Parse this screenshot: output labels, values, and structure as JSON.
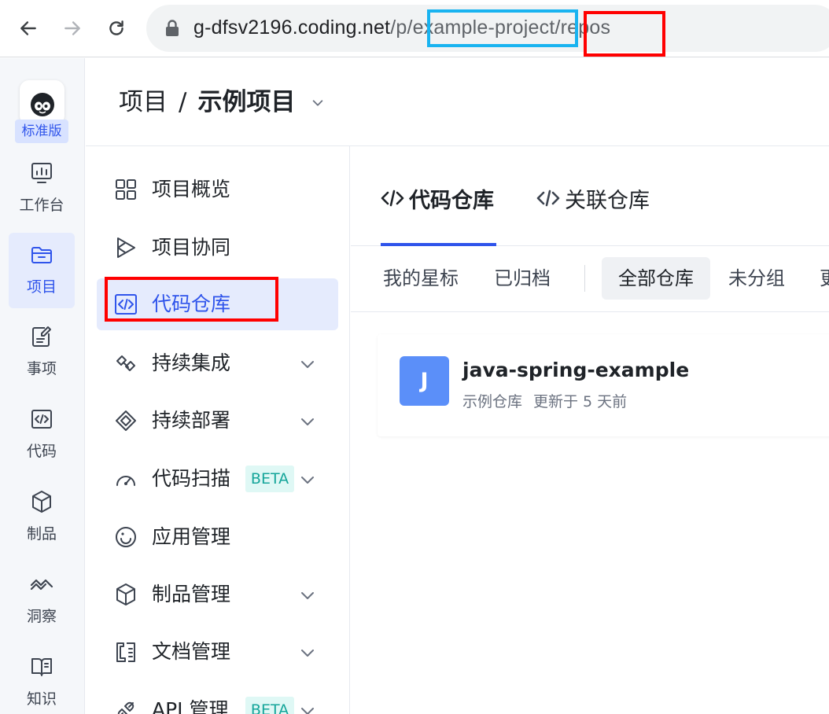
{
  "browser": {
    "url_domain": "g-dfsv2196.coding.net",
    "url_seg1": "/p/",
    "url_project": "example-project",
    "url_slash": "/",
    "url_repos": "repos"
  },
  "rail": {
    "plan": "标准版",
    "items": [
      {
        "label": "工作台",
        "icon": "dashboard-icon"
      },
      {
        "label": "项目",
        "icon": "folder-icon"
      },
      {
        "label": "事项",
        "icon": "issue-icon"
      },
      {
        "label": "代码",
        "icon": "code-icon"
      },
      {
        "label": "制品",
        "icon": "cube-icon"
      },
      {
        "label": "洞察",
        "icon": "insight-icon"
      },
      {
        "label": "知识",
        "icon": "book-icon"
      }
    ]
  },
  "header": {
    "root": "项目",
    "separator": "/",
    "current": "示例项目"
  },
  "sidebar": {
    "items": [
      {
        "label": "项目概览"
      },
      {
        "label": "项目协同"
      },
      {
        "label": "代码仓库"
      },
      {
        "label": "持续集成"
      },
      {
        "label": "持续部署"
      },
      {
        "label": "代码扫描",
        "badge": "BETA"
      },
      {
        "label": "应用管理"
      },
      {
        "label": "制品管理"
      },
      {
        "label": "文档管理"
      },
      {
        "label": "API 管理",
        "badge": "BETA"
      }
    ]
  },
  "tabs": [
    {
      "label": "代码仓库"
    },
    {
      "label": "关联仓库"
    }
  ],
  "filters": {
    "starred": "我的星标",
    "archived": "已归档",
    "all": "全部仓库",
    "ungrouped": "未分组",
    "more": "更"
  },
  "repo": {
    "avatar_letter": "J",
    "name": "java-spring-example",
    "description": "示例仓库",
    "updated": "更新于 5 天前"
  },
  "colors": {
    "accent": "#2f54eb",
    "active_bg": "#e5ebfd",
    "beta_bg": "#dff8f5",
    "beta_text": "#15a59a",
    "avatar_bg": "#5b8ff9",
    "annotation_red": "#ff0000",
    "annotation_blue": "#19b3f0"
  }
}
